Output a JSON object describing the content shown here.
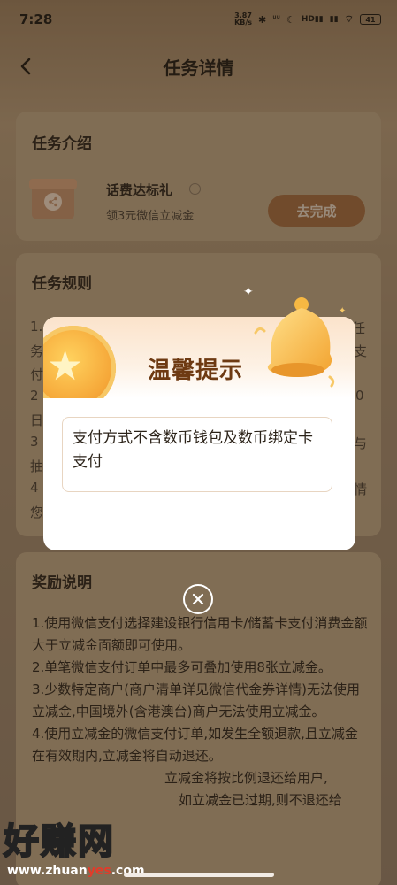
{
  "status_bar": {
    "time": "7:28",
    "speed": "3.87",
    "speed_unit": "KB/s",
    "signal_label": "HD",
    "battery": "41"
  },
  "header": {
    "title": "任务详情"
  },
  "task_intro": {
    "title": "任务介绍",
    "task_name": "话费达标礼",
    "task_desc": "领3元微信立减金",
    "button_label": "去完成"
  },
  "task_rules": {
    "title": "任务规则",
    "lines": [
      "1.",
      "任",
      "务",
      "支",
      "付",
      "2",
      "0",
      "日",
      "3",
      "与",
      "抽",
      "4",
      "情",
      "您"
    ]
  },
  "reward": {
    "title": "奖励说明",
    "paragraphs": [
      "1.使用微信支付选择建设银行信用卡/储蓄卡支付消费金额大于立减金面额即可使用。",
      "2.单笔微信支付订单中最多可叠加使用8张立减金。",
      "3.少数特定商户(商户清单详见微信代金券详情)无法使用立减金,中国境外(含港澳台)商户无法使用立减金。",
      "4.使用立减金的微信支付订单,如发生全额退款,且立减金在有效期内,立减金将自动退还。",
      "立减金将按比例退还给用户,",
      "如立减金已过期,则不退还给"
    ]
  },
  "modal": {
    "title": "温馨提示",
    "message": "支付方式不含数币钱包及数币绑定卡支付"
  },
  "watermark": {
    "text": "好赚网",
    "url_prefix": "www.zhuan",
    "url_accent": "yes",
    "url_suffix": ".com",
    "accent_color": "#e23b2a"
  },
  "icons": {
    "back": "chevron-left-icon",
    "close": "close-circle-icon",
    "info": "info-icon",
    "gift": "gift-share-icon"
  }
}
